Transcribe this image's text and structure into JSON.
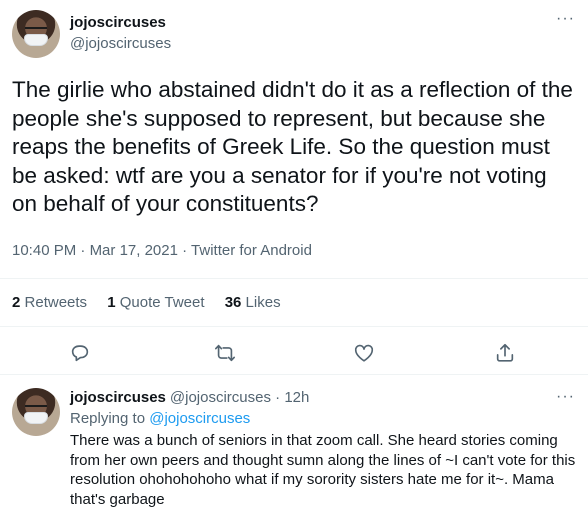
{
  "tweet": {
    "display_name": "jojoscircuses",
    "handle": "@jojoscircuses",
    "text": "The girlie who abstained didn't do it as a reflection of the people she's supposed to represent, but because she reaps the benefits of Greek Life. So the question must be asked: wtf are you a senator for if you're not voting on behalf of your constituents?",
    "time": "10:40 PM",
    "date": "Mar 17, 2021",
    "source": "Twitter for Android",
    "stats": {
      "retweets_count": "2",
      "retweets_label": "Retweets",
      "quotes_count": "1",
      "quotes_label": "Quote Tweet",
      "likes_count": "36",
      "likes_label": "Likes"
    },
    "more_icon": "ellipsis-icon"
  },
  "actions": [
    {
      "icon": "reply-icon"
    },
    {
      "icon": "retweet-icon"
    },
    {
      "icon": "like-icon"
    },
    {
      "icon": "share-icon"
    }
  ],
  "reply": {
    "display_name": "jojoscircuses",
    "handle": "@jojoscircuses",
    "age": "12h",
    "replying_prefix": "Replying to",
    "replying_to": "@jojoscircuses",
    "text": "There was a bunch of seniors in that zoom call. She heard stories coming from her own peers and thought sumn along the lines of ~I can't vote for this resolution ohohohohoho what if my sorority sisters hate me for it~. Mama that's garbage"
  },
  "colors": {
    "text_primary": "#0f1419",
    "text_secondary": "#536471",
    "link": "#1d9bf0",
    "divider": "#eff3f4"
  }
}
